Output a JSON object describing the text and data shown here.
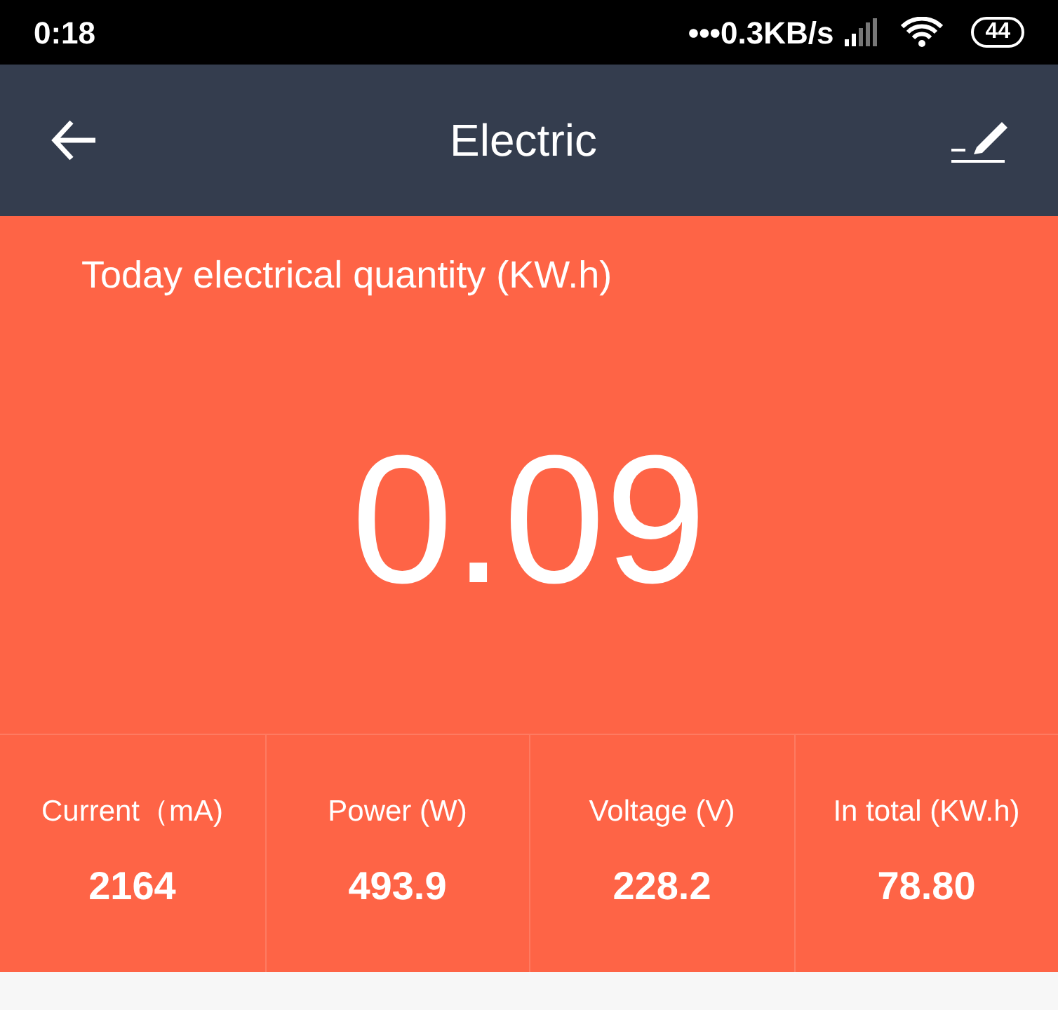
{
  "status_bar": {
    "time": "0:18",
    "dots": "•••",
    "speed": "0.3KB/s",
    "battery": "44"
  },
  "header": {
    "title": "Electric"
  },
  "today": {
    "label": "Today electrical quantity (KW.h)",
    "value": "0.09"
  },
  "stats": [
    {
      "label": "Current（mA)",
      "value": "2164"
    },
    {
      "label": "Power (W)",
      "value": "493.9"
    },
    {
      "label": "Voltage (V)",
      "value": "228.2"
    },
    {
      "label": "In total (KW.h)",
      "value": "78.80"
    }
  ]
}
